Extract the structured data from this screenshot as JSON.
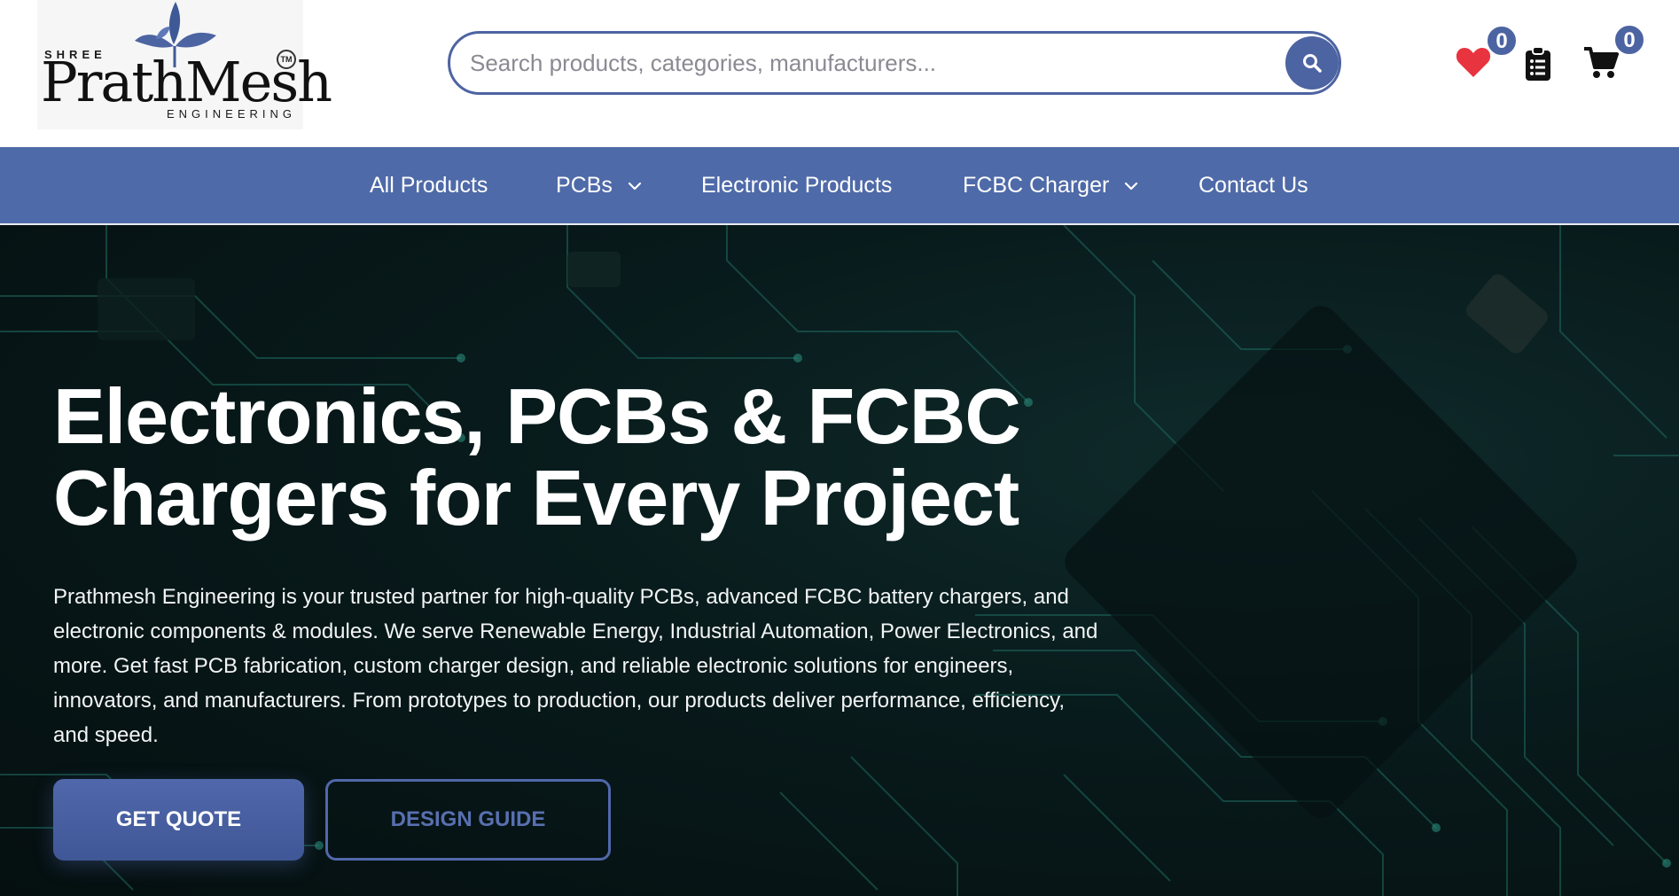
{
  "header": {
    "logo": {
      "top_text": "SHREE",
      "brand": "PrathMesh",
      "tm": "TM",
      "bottom_text": "ENGINEERING"
    },
    "search": {
      "placeholder": "Search products, categories, manufacturers...",
      "value": "",
      "icon": "search-icon"
    },
    "wishlist": {
      "icon": "heart-icon",
      "count": "0",
      "color": "#e8343e"
    },
    "quote_list": {
      "icon": "clipboard-list-icon"
    },
    "cart": {
      "icon": "shopping-cart-icon",
      "count": "0"
    }
  },
  "nav": {
    "items": [
      {
        "label": "All Products",
        "has_dropdown": false
      },
      {
        "label": "PCBs",
        "has_dropdown": true
      },
      {
        "label": "Electronic Products",
        "has_dropdown": false
      },
      {
        "label": "FCBC Charger",
        "has_dropdown": true
      },
      {
        "label": "Contact Us",
        "has_dropdown": false
      }
    ]
  },
  "hero": {
    "title_line1": "Electronics, PCBs & FCBC",
    "title_line2": "Chargers for Every Project",
    "description": "Prathmesh Engineering is your trusted partner for high-quality PCBs, advanced FCBC battery chargers, and electronic components & modules. We serve Renewable Energy, Industrial Automation, Power Electronics, and more. Get fast PCB fabrication, custom charger design, and reliable electronic solutions for engineers, innovators, and manufacturers. From prototypes to production, our products deliver performance, efficiency, and speed.",
    "primary_button": "GET QUOTE",
    "secondary_button": "DESIGN GUIDE"
  },
  "colors": {
    "brand": "#4d64a2",
    "nav_background": "#4f6aa8",
    "hero_background": "#081a1b",
    "wishlist_heart": "#e8343e"
  }
}
